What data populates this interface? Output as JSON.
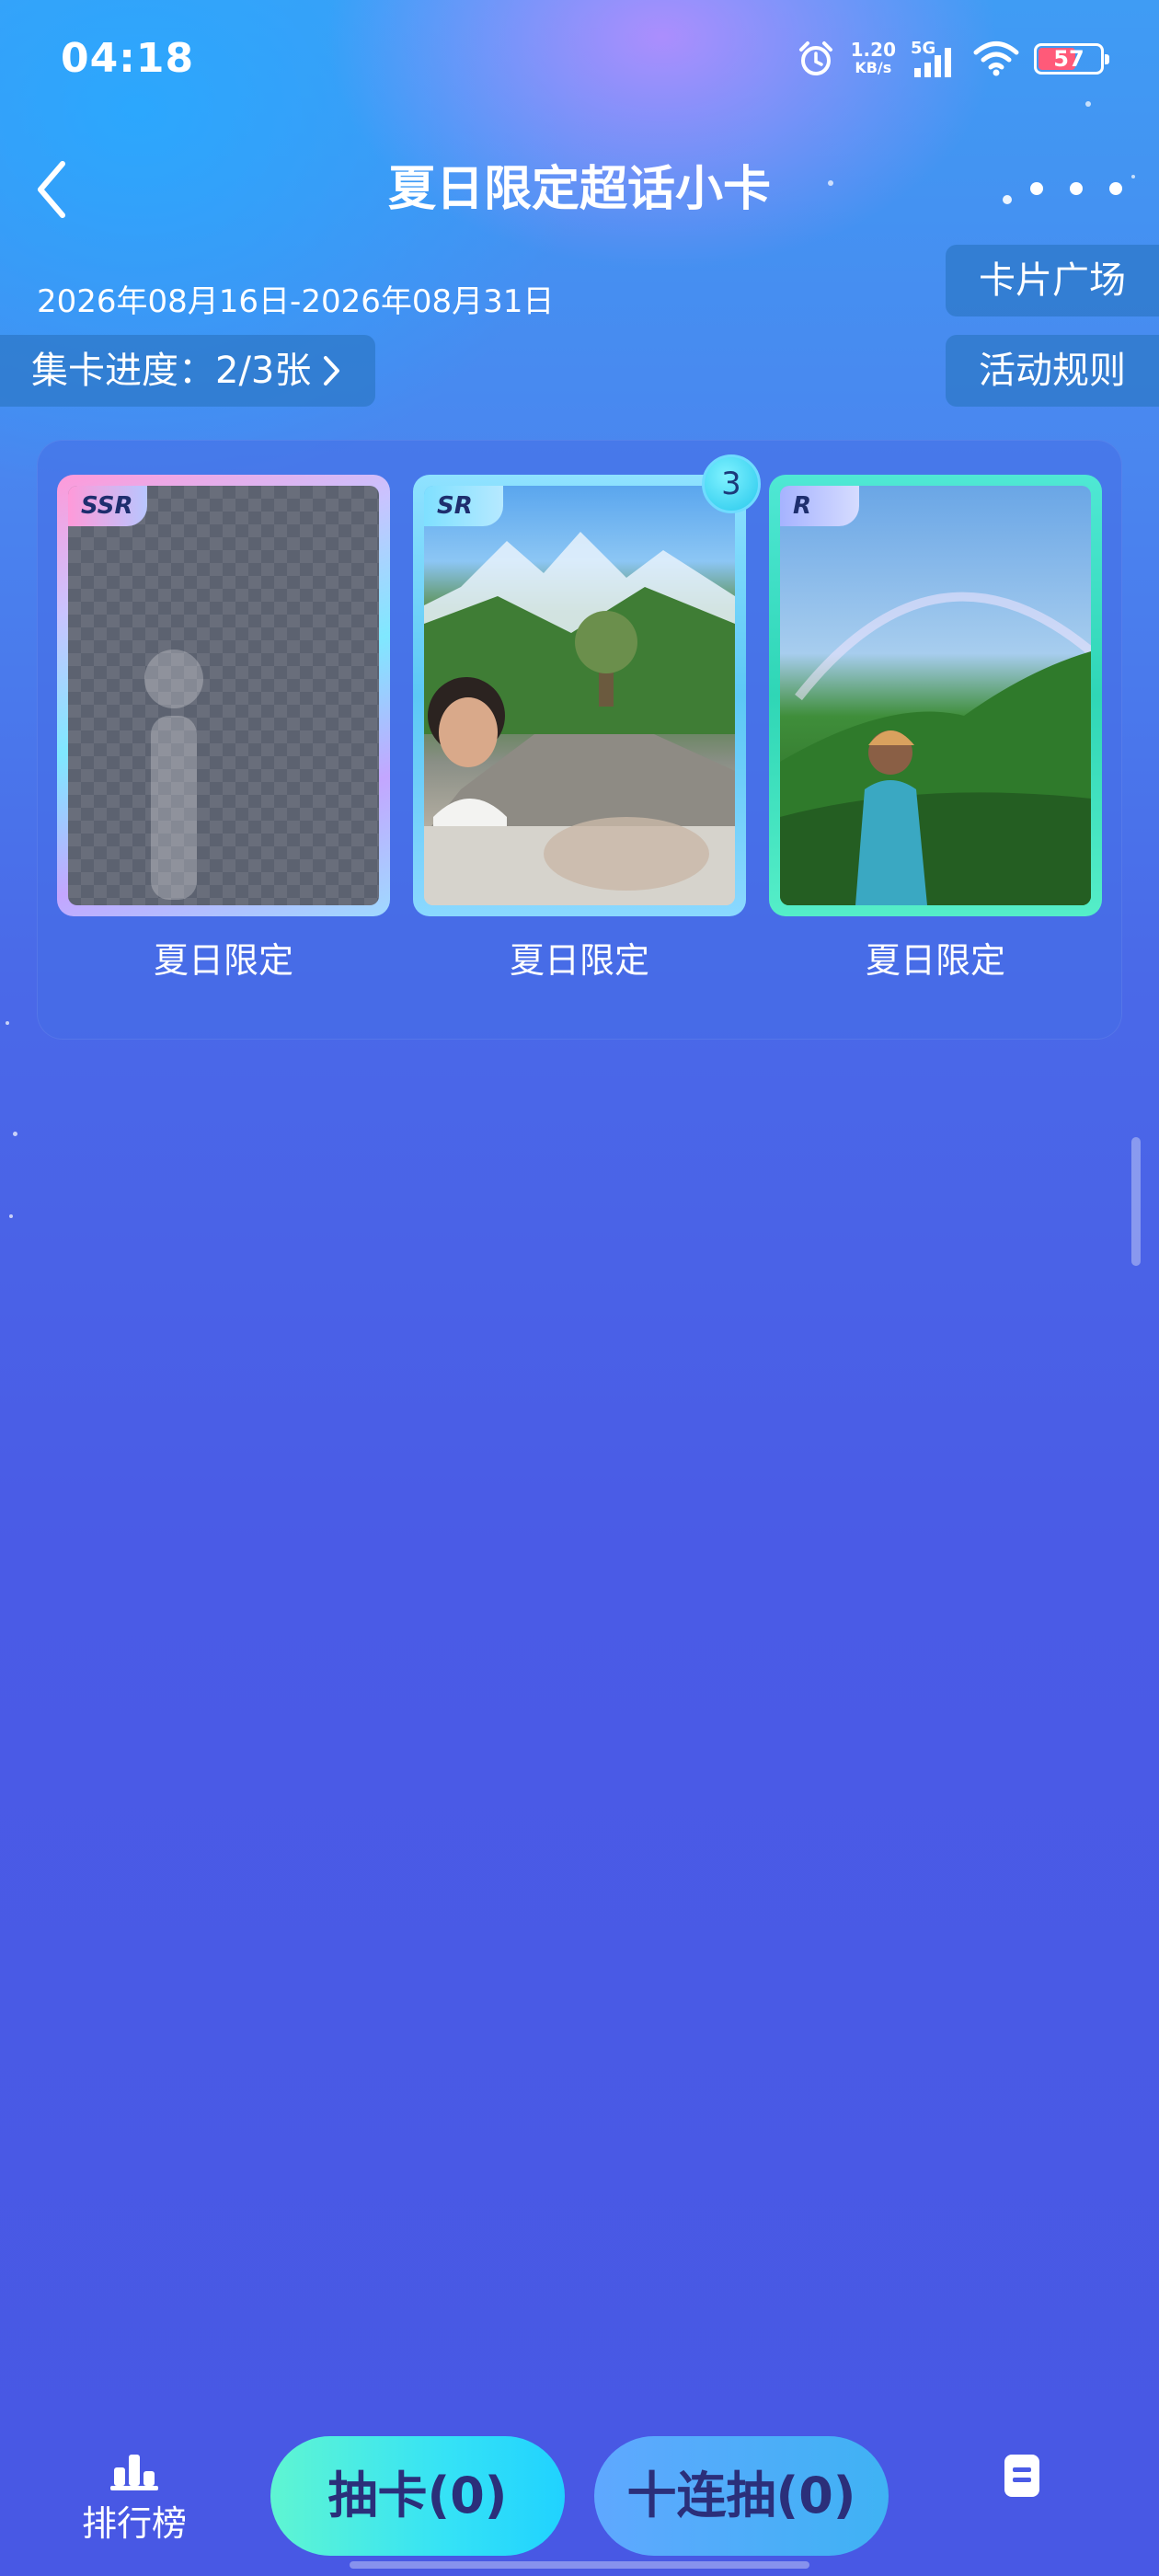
{
  "status_bar": {
    "time": "04:18",
    "net_speed_value": "1.20",
    "net_speed_unit": "KB/s",
    "network_type": "5G",
    "battery": "57",
    "icons": [
      "alarm-icon",
      "signal-icon",
      "wifi-icon",
      "battery-icon"
    ]
  },
  "header": {
    "title": "夏日限定超话小卡",
    "back_icon": "chevron-left-icon",
    "more_icon": "more-icon"
  },
  "info": {
    "date_range": "2026年08月16日-2026年08月31日",
    "progress_label": "集卡进度：2/3张",
    "card_plaza": "卡片广场",
    "rules": "活动规则"
  },
  "cards": [
    {
      "rarity": "SSR",
      "name": "夏日限定",
      "owned": false,
      "count": ""
    },
    {
      "rarity": "SR",
      "name": "夏日限定",
      "owned": true,
      "count": "3"
    },
    {
      "rarity": "R",
      "name": "夏日限定",
      "owned": true,
      "count": ""
    }
  ],
  "bottom_bar": {
    "rank_label": "排行榜",
    "draw_label": "抽卡(0)",
    "draw_ten_label": "十连抽(0)",
    "icons": [
      "leaderboard-icon",
      "document-icon"
    ]
  },
  "colors": {
    "bg_top": "#3f9cf4",
    "bg_bottom": "#4858e4",
    "draw_button": "#35e2f6",
    "draw_ten_button": "#4fadf8",
    "button_text": "#2b2f7a"
  }
}
